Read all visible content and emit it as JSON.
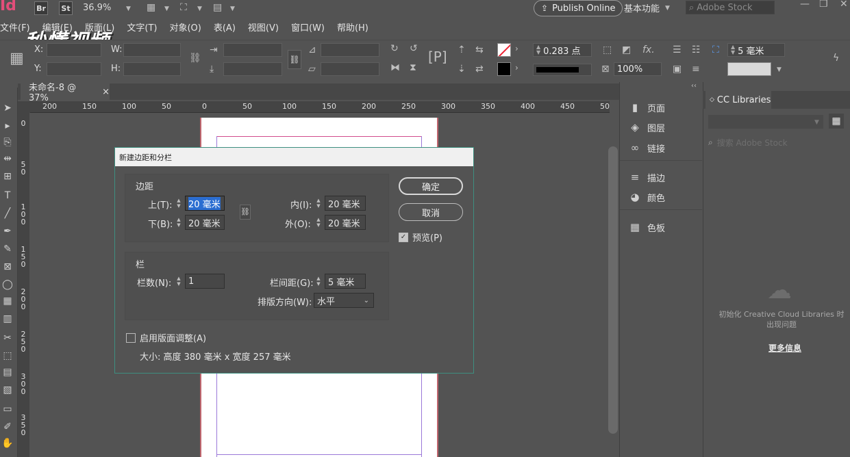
{
  "app": {
    "brand": "Id",
    "bridge_icon": "Br",
    "stock_icon": "St",
    "zoom": "36.9%",
    "publish_button": "Publish Online",
    "workspace": "基本功能",
    "stock_search_placeholder": "Adobe Stock"
  },
  "watermark": "秒懂视频",
  "menu": [
    "文件(F)",
    "编辑(E)",
    "版面(L)",
    "文字(T)",
    "对象(O)",
    "表(A)",
    "视图(V)",
    "窗口(W)",
    "帮助(H)"
  ],
  "control": {
    "x_label": "X:",
    "y_label": "Y:",
    "w_label": "W:",
    "h_label": "H:",
    "stroke_weight": "0.283 点",
    "scale_pct": "100%",
    "gutter_value": "5 毫米"
  },
  "document": {
    "tab_title": "未命名-8 @ 37%",
    "close": "×"
  },
  "ruler": {
    "h_ticks": [
      "200",
      "150",
      "100",
      "50",
      "0",
      "50",
      "100",
      "150",
      "200",
      "250",
      "300",
      "350",
      "400",
      "450",
      "50"
    ],
    "v_ticks": [
      "0",
      "50",
      "100",
      "150",
      "200",
      "250",
      "300",
      "350"
    ]
  },
  "panels": {
    "items": [
      "页面",
      "图层",
      "链接",
      "描边",
      "颜色",
      "色板"
    ],
    "cc_tab": "CC Libraries",
    "cc_search_placeholder": "搜索 Adobe Stock",
    "cc_message": "初始化 Creative Cloud Libraries 时出现问题",
    "cc_more": "更多信息"
  },
  "dialog": {
    "title": "新建边距和分栏",
    "margins_heading": "边距",
    "top_label": "上(T):",
    "top_value": "20 毫米",
    "bottom_label": "下(B):",
    "bottom_value": "20 毫米",
    "inside_label": "内(I):",
    "inside_value": "20 毫米",
    "outside_label": "外(O):",
    "outside_value": "20 毫米",
    "columns_heading": "栏",
    "count_label": "栏数(N):",
    "count_value": "1",
    "gutter_label": "栏间距(G):",
    "gutter_value": "5 毫米",
    "direction_label": "排版方向(W):",
    "direction_value": "水平",
    "ok": "确定",
    "cancel": "取消",
    "preview_label": "预览(P)",
    "preview_checked": true,
    "layout_adjust_label": "启用版面调整(A)",
    "layout_adjust_checked": false,
    "size_text": "大小: 高度 380 毫米 x 宽度 257 毫米"
  }
}
